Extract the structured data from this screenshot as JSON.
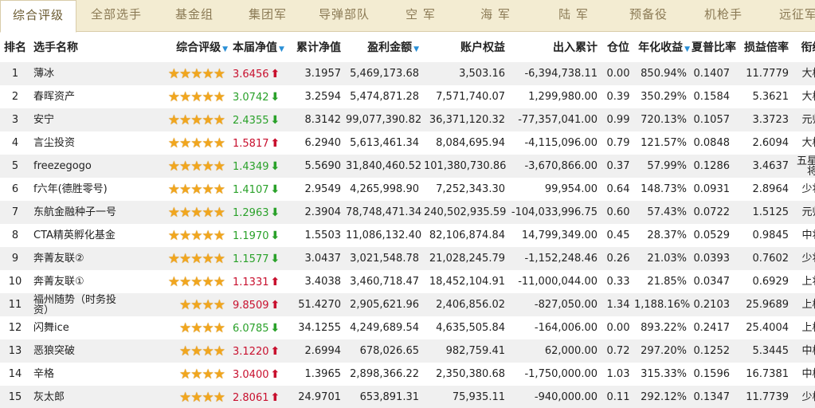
{
  "tabs": [
    {
      "label": "综合评级",
      "active": true
    },
    {
      "label": "全部选手",
      "active": false
    },
    {
      "label": "基金组",
      "active": false
    },
    {
      "label": "集团军",
      "active": false
    },
    {
      "label": "导弹部队",
      "active": false
    },
    {
      "label": "空  军",
      "active": false
    },
    {
      "label": "海  军",
      "active": false
    },
    {
      "label": "陆  军",
      "active": false
    },
    {
      "label": "预备役",
      "active": false
    },
    {
      "label": "机枪手",
      "active": false
    },
    {
      "label": "远征军",
      "active": false
    }
  ],
  "headers": {
    "rank": "排名",
    "name": "选手名称",
    "rating": "综合评级",
    "nav": "本届净值",
    "cum_nav": "累计净值",
    "profit": "盈利金额",
    "equity": "账户权益",
    "flow": "出入累计",
    "position": "仓位",
    "annual": "年化收益",
    "sharpe": "夏普比率",
    "pl_ratio": "损益倍率",
    "title": "衔级"
  },
  "sort_indicator": "▼",
  "rows": [
    {
      "rank": "1",
      "name": "薄冰",
      "stars": "★★★★★",
      "nav": "3.6456",
      "dir": "up",
      "cum_nav": "3.1957",
      "profit": "5,469,173.68",
      "equity": "3,503.16",
      "flow": "-6,394,738.11",
      "position": "0.00",
      "annual": "850.94%",
      "sharpe": "0.1407",
      "pl_ratio": "11.7779",
      "title": "大校"
    },
    {
      "rank": "2",
      "name": "春晖资产",
      "stars": "★★★★★",
      "nav": "3.0742",
      "dir": "down",
      "cum_nav": "3.2594",
      "profit": "5,474,871.28",
      "equity": "7,571,740.07",
      "flow": "1,299,980.00",
      "position": "0.39",
      "annual": "350.29%",
      "sharpe": "0.1584",
      "pl_ratio": "5.3621",
      "title": "大校"
    },
    {
      "rank": "3",
      "name": "安宁",
      "stars": "★★★★★",
      "nav": "2.4355",
      "dir": "down",
      "cum_nav": "8.3142",
      "profit": "99,077,390.82",
      "equity": "36,371,120.32",
      "flow": "-77,357,041.00",
      "position": "0.99",
      "annual": "720.13%",
      "sharpe": "0.1057",
      "pl_ratio": "3.3723",
      "title": "元帅"
    },
    {
      "rank": "4",
      "name": "言尘投资",
      "stars": "★★★★★",
      "nav": "1.5817",
      "dir": "up",
      "cum_nav": "6.2940",
      "profit": "5,613,461.34",
      "equity": "8,084,695.94",
      "flow": "-4,115,096.00",
      "position": "0.79",
      "annual": "121.57%",
      "sharpe": "0.0848",
      "pl_ratio": "2.6094",
      "title": "大校"
    },
    {
      "rank": "5",
      "name": "freezegogo",
      "stars": "★★★★★",
      "nav": "1.4349",
      "dir": "down",
      "cum_nav": "5.5690",
      "profit": "31,840,460.52",
      "equity": "101,380,730.86",
      "flow": "-3,670,866.00",
      "position": "0.37",
      "annual": "57.99%",
      "sharpe": "0.1286",
      "pl_ratio": "3.4637",
      "title": "五星上将"
    },
    {
      "rank": "6",
      "name": "f六年(德胜零号)",
      "stars": "★★★★★",
      "nav": "1.4107",
      "dir": "down",
      "cum_nav": "2.9549",
      "profit": "4,265,998.90",
      "equity": "7,252,343.30",
      "flow": "99,954.00",
      "position": "0.64",
      "annual": "148.73%",
      "sharpe": "0.0931",
      "pl_ratio": "2.8964",
      "title": "少将"
    },
    {
      "rank": "7",
      "name": "东航金融种子一号",
      "stars": "★★★★★",
      "nav": "1.2963",
      "dir": "down",
      "cum_nav": "2.3904",
      "profit": "78,748,471.34",
      "equity": "240,502,935.59",
      "flow": "-104,033,996.75",
      "position": "0.60",
      "annual": "57.43%",
      "sharpe": "0.0722",
      "pl_ratio": "1.5125",
      "title": "元帅"
    },
    {
      "rank": "8",
      "name": "CTA精英孵化基金",
      "stars": "★★★★★",
      "nav": "1.1970",
      "dir": "down",
      "cum_nav": "1.5503",
      "profit": "11,086,132.40",
      "equity": "82,106,874.84",
      "flow": "14,799,349.00",
      "position": "0.45",
      "annual": "28.37%",
      "sharpe": "0.0529",
      "pl_ratio": "0.9845",
      "title": "中将"
    },
    {
      "rank": "9",
      "name": "奔菁友联②",
      "stars": "★★★★★",
      "nav": "1.1577",
      "dir": "down",
      "cum_nav": "3.0437",
      "profit": "3,021,548.78",
      "equity": "21,028,245.79",
      "flow": "-1,152,248.46",
      "position": "0.26",
      "annual": "21.03%",
      "sharpe": "0.0393",
      "pl_ratio": "0.7602",
      "title": "少将"
    },
    {
      "rank": "10",
      "name": "奔菁友联①",
      "stars": "★★★★★",
      "nav": "1.1331",
      "dir": "up",
      "cum_nav": "3.4038",
      "profit": "3,460,718.47",
      "equity": "18,452,104.91",
      "flow": "-11,000,044.00",
      "position": "0.33",
      "annual": "21.85%",
      "sharpe": "0.0347",
      "pl_ratio": "0.6929",
      "title": "上将"
    },
    {
      "rank": "11",
      "name": "福州随势（时务投资）",
      "stars": "★★★★",
      "nav": "9.8509",
      "dir": "up",
      "cum_nav": "51.4270",
      "profit": "2,905,621.96",
      "equity": "2,406,856.02",
      "flow": "-827,050.00",
      "position": "1.34",
      "annual": "1,188.16%",
      "sharpe": "0.2103",
      "pl_ratio": "25.9689",
      "title": "上校"
    },
    {
      "rank": "12",
      "name": "闪舞ice",
      "stars": "★★★★",
      "nav": "6.0785",
      "dir": "down",
      "cum_nav": "34.1255",
      "profit": "4,249,689.54",
      "equity": "4,635,505.84",
      "flow": "-164,006.00",
      "position": "0.00",
      "annual": "893.22%",
      "sharpe": "0.2417",
      "pl_ratio": "25.4004",
      "title": "上校"
    },
    {
      "rank": "13",
      "name": "恶狼突破",
      "stars": "★★★★",
      "nav": "3.1220",
      "dir": "up",
      "cum_nav": "2.6994",
      "profit": "678,026.65",
      "equity": "982,759.41",
      "flow": "62,000.00",
      "position": "0.72",
      "annual": "297.20%",
      "sharpe": "0.1252",
      "pl_ratio": "5.3445",
      "title": "中校"
    },
    {
      "rank": "14",
      "name": "辛格",
      "stars": "★★★★",
      "nav": "3.0400",
      "dir": "up",
      "cum_nav": "1.3965",
      "profit": "2,898,366.22",
      "equity": "2,350,380.68",
      "flow": "-1,750,000.00",
      "position": "1.03",
      "annual": "315.33%",
      "sharpe": "0.1596",
      "pl_ratio": "16.7381",
      "title": "中校"
    },
    {
      "rank": "15",
      "name": "灰太郎",
      "stars": "★★★★",
      "nav": "2.8061",
      "dir": "up",
      "cum_nav": "24.9701",
      "profit": "653,891.31",
      "equity": "75,935.11",
      "flow": "-940,000.00",
      "position": "0.11",
      "annual": "292.12%",
      "sharpe": "0.1347",
      "pl_ratio": "11.7739",
      "title": "少校"
    }
  ],
  "colors": {
    "up": "#c8102e",
    "down": "#2aa12a",
    "star": "#f1a61e",
    "sort": "#2a8fd6",
    "tab_bar": "#f3ecd2"
  },
  "icons": {
    "up": "arrow-up-icon",
    "down": "arrow-down-icon",
    "sort": "sort-desc-icon",
    "star": "star-icon"
  }
}
